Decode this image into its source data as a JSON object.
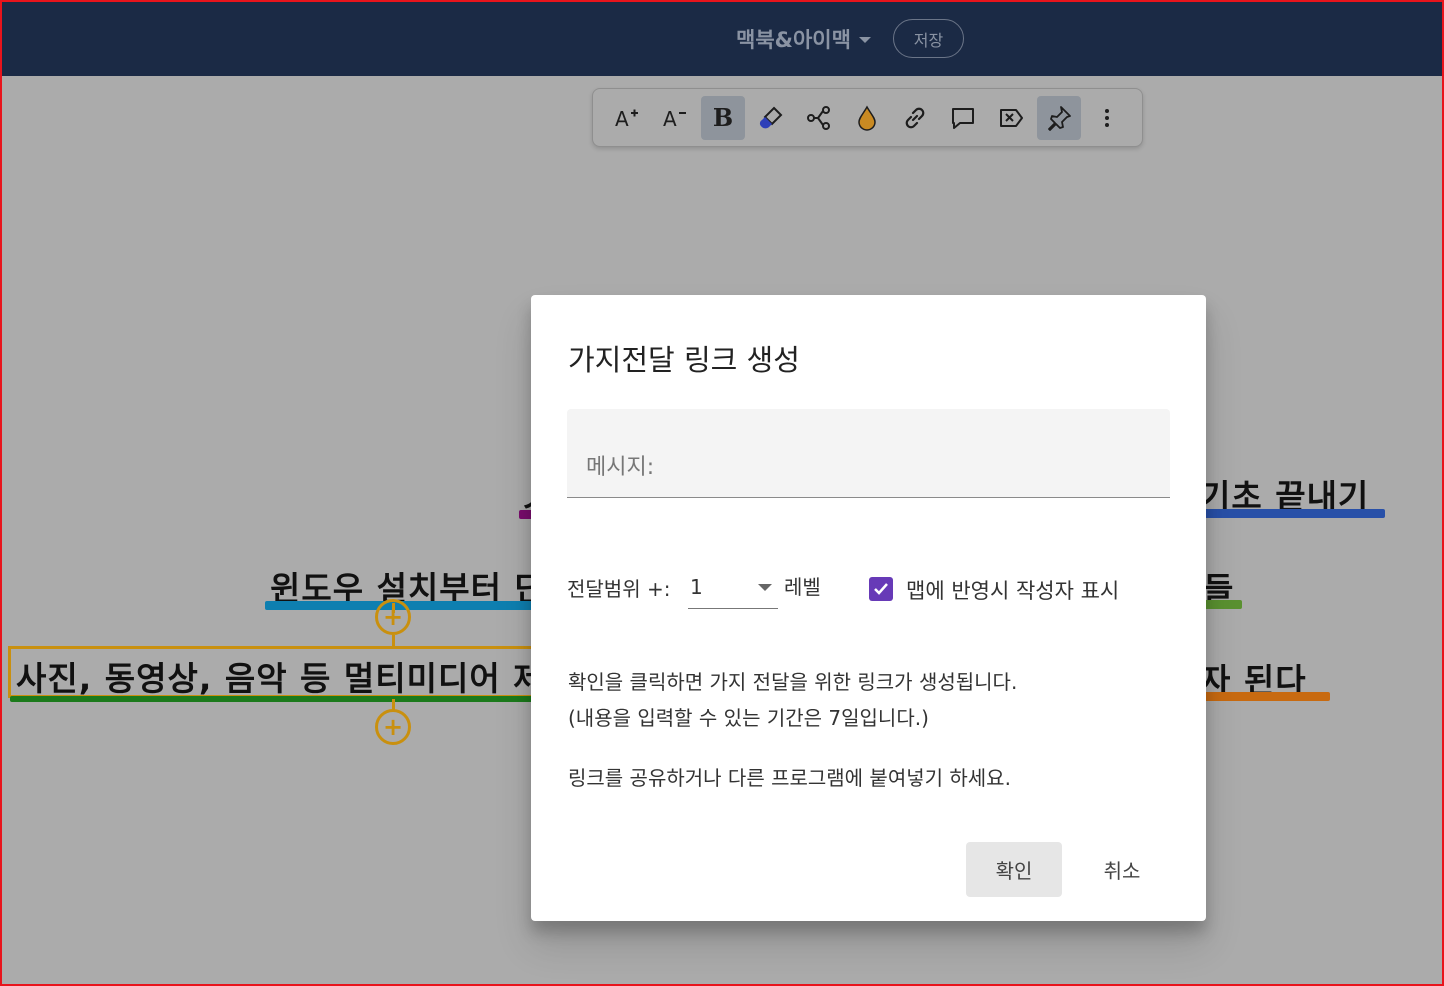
{
  "header": {
    "map_title": "맥북&아이맥",
    "save_label": "저장"
  },
  "toolbar": {
    "buttons": [
      {
        "name": "font-increase-icon",
        "active": false
      },
      {
        "name": "font-decrease-icon",
        "active": false
      },
      {
        "name": "bold-icon",
        "label": "B",
        "active": true
      },
      {
        "name": "paint-brush-icon",
        "active": false
      },
      {
        "name": "share-nodes-icon",
        "active": false
      },
      {
        "name": "color-drop-icon",
        "active": false
      },
      {
        "name": "link-icon",
        "active": false
      },
      {
        "name": "comment-icon",
        "active": false
      },
      {
        "name": "clear-tag-icon",
        "active": false
      },
      {
        "name": "pin-icon",
        "active": true
      },
      {
        "name": "more-vertical-icon",
        "active": false
      }
    ]
  },
  "map": {
    "nodes": [
      {
        "text": "윈도우 설치부터 단"
      },
      {
        "text": "사진, 동영상, 음악 등 멀티미디어 제"
      },
      {
        "text": "기초 끝내기"
      },
      {
        "text": "들"
      },
      {
        "text": "자 된다"
      }
    ]
  },
  "dialog": {
    "title": "가지전달 링크 생성",
    "message_placeholder": "메시지:",
    "scope_label": "전달범위 +:",
    "scope_value": "1",
    "level_label": "레벨",
    "show_author_label": "맵에 반영시 작성자 표시",
    "show_author_checked": true,
    "info_line1": "확인을 클릭하면 가지 전달을 위한 링크가 생성됩니다.",
    "info_line2": "(내용을 입력할 수 있는 기간은 7일입니다.)",
    "info_line3": "링크를 공유하거나 다른 프로그램에 붙여넣기 하세요.",
    "ok_label": "확인",
    "cancel_label": "취소"
  },
  "colors": {
    "header_bg": "#1b2a45",
    "overlay_bg": "#ababab",
    "checkbox": "#673ab7",
    "node_accent": "#c9900f"
  }
}
